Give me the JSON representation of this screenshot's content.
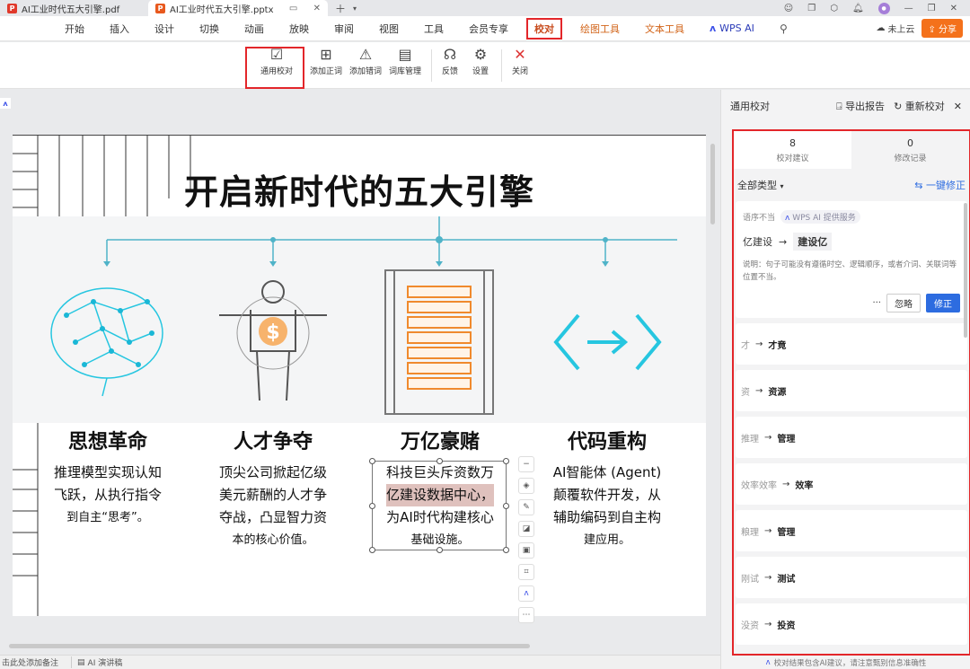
{
  "tabs": [
    {
      "label": "AI工业时代五大引擎.pdf",
      "icon": "P"
    },
    {
      "label": "AI工业时代五大引擎.pptx",
      "icon": "P"
    }
  ],
  "menu": [
    "开始",
    "插入",
    "设计",
    "切换",
    "动画",
    "放映",
    "审阅",
    "视图",
    "工具",
    "会员专享",
    "校对",
    "绘图工具",
    "文本工具",
    "WPS AI"
  ],
  "menu_right": {
    "cloud": "未上云",
    "share": "分享"
  },
  "ribbon": [
    {
      "label": "通用校对",
      "icon": "☑"
    },
    {
      "label": "添加正词",
      "icon": "⊞"
    },
    {
      "label": "添加错词",
      "icon": "⚠"
    },
    {
      "label": "词库管理",
      "icon": "▤"
    },
    {
      "label": "反馈",
      "icon": "☊"
    },
    {
      "label": "设置",
      "icon": "⚙"
    },
    {
      "label": "关闭",
      "icon": "✕"
    }
  ],
  "slide": {
    "title": "开启新时代的五大引擎",
    "cards": [
      {
        "title": "思想革命",
        "desc": [
          "推理模型实现认知",
          "飞跃，从执行指令",
          "到自主“思考”。"
        ]
      },
      {
        "title": "人才争夺",
        "desc": [
          "顶尖公司掀起亿级",
          "美元薪酬的人才争",
          "夺战，凸显智力资",
          "本的核心价值。"
        ]
      },
      {
        "title": "万亿豪赌",
        "desc": [
          "科技巨头斥资数万",
          "亿建设数据中心，",
          "为AI时代构建核心",
          "基础设施。"
        ]
      },
      {
        "title": "代码重构",
        "desc": [
          "AI智能体 (Agent)",
          "颠覆软件开发，从",
          "辅助编码到自主构",
          "建应用。"
        ]
      }
    ]
  },
  "statusbar": {
    "notes": "击此处添加备注",
    "ai_notes": "AI 演讲稿"
  },
  "panel": {
    "title": "通用校对",
    "export": "导出报告",
    "recheck": "重新校对",
    "stats": [
      {
        "count": "8",
        "label": "校对建议"
      },
      {
        "count": "0",
        "label": "修改记录"
      }
    ],
    "filter": "全部类型",
    "fix_all": "一键修正",
    "main_suggestion": {
      "tag": "语序不当",
      "provider": "WPS AI 提供服务",
      "old": "亿建设",
      "new": "建设亿",
      "explain": "说明：句子可能没有遵循时空、逻辑顺序，或者介词、关联词等位置不当。",
      "more": "···",
      "ignore": "忽略",
      "fix": "修正"
    },
    "suggestions": [
      {
        "old": "才",
        "new": "才竟"
      },
      {
        "old": "资",
        "new": "资源"
      },
      {
        "old": "推理",
        "new": "管理"
      },
      {
        "old": "效率效率",
        "new": "效率"
      },
      {
        "old": "粮理",
        "new": "管理"
      },
      {
        "old": "刚试",
        "new": "测试"
      },
      {
        "old": "没资",
        "new": "投资"
      }
    ],
    "footer": "校对结果包含AI建议，请注意甄别信息准确性"
  }
}
